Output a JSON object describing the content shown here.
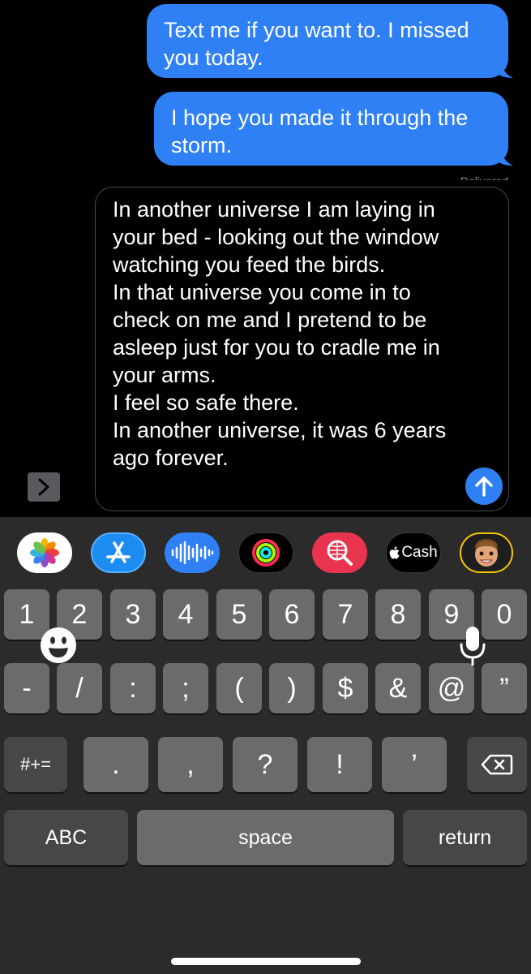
{
  "thread": {
    "messages": [
      {
        "text": "Text me if you want to. I missed you today."
      },
      {
        "text": "I hope you made it through the storm."
      }
    ],
    "status": "Delivered"
  },
  "compose": {
    "text": "In another universe I am laying in your bed - looking out the window watching you feed the birds.\nIn that universe you come in to check on me and I pretend to be asleep just for you to cradle me in your arms.\nI feel so safe there.\nIn another universe, it was 6 years ago forever."
  },
  "app_strip": {
    "apps": [
      {
        "icon": "photos-icon"
      },
      {
        "icon": "app-store-icon"
      },
      {
        "icon": "audio-message-icon"
      },
      {
        "icon": "activity-icon"
      },
      {
        "icon": "image-search-icon"
      },
      {
        "icon": "apple-cash-icon",
        "label": "Cash"
      },
      {
        "icon": "memoji-icon"
      }
    ]
  },
  "keyboard": {
    "row1": [
      "1",
      "2",
      "3",
      "4",
      "5",
      "6",
      "7",
      "8",
      "9",
      "0"
    ],
    "row2": [
      "-",
      "/",
      ":",
      ";",
      "(",
      ")",
      "$",
      "&",
      "@",
      "”"
    ],
    "row3": [
      "#+=",
      ".",
      ",",
      "?",
      "!",
      "’"
    ],
    "row4": {
      "abc": "ABC",
      "space": "space",
      "return": "return"
    }
  },
  "colors": {
    "bubble": "#2f80f5",
    "keyboard_bg": "#2b2b2b",
    "key": "#6b6b6b",
    "key_dark": "#474747"
  }
}
